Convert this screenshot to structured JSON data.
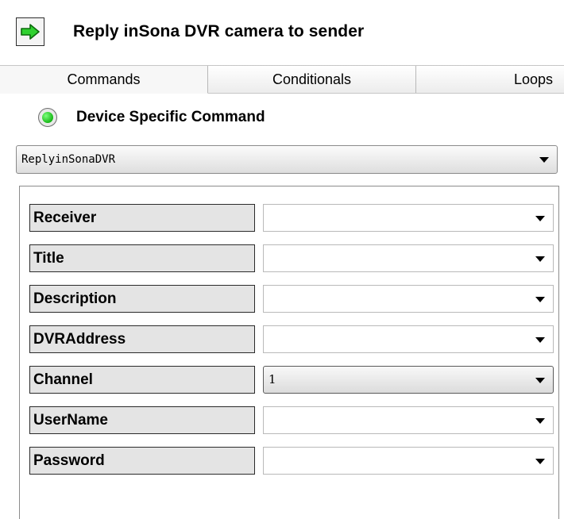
{
  "header": {
    "title": "Reply inSona DVR camera to sender",
    "icon": "green-arrow-right"
  },
  "tabs": [
    {
      "label": "Commands",
      "active": true
    },
    {
      "label": "Conditionals",
      "active": false
    },
    {
      "label": "Loops",
      "active": false
    }
  ],
  "command_type": {
    "label": "Device Specific Command",
    "selected": true
  },
  "command_select": {
    "value": "ReplyinSonaDVR"
  },
  "params": [
    {
      "label": "Receiver",
      "value": ""
    },
    {
      "label": "Title",
      "value": ""
    },
    {
      "label": "Description",
      "value": ""
    },
    {
      "label": "DVRAddress",
      "value": ""
    },
    {
      "label": "Channel",
      "value": "1"
    },
    {
      "label": "UserName",
      "value": ""
    },
    {
      "label": "Password",
      "value": ""
    }
  ],
  "colors": {
    "accent_green": "#18b818"
  }
}
